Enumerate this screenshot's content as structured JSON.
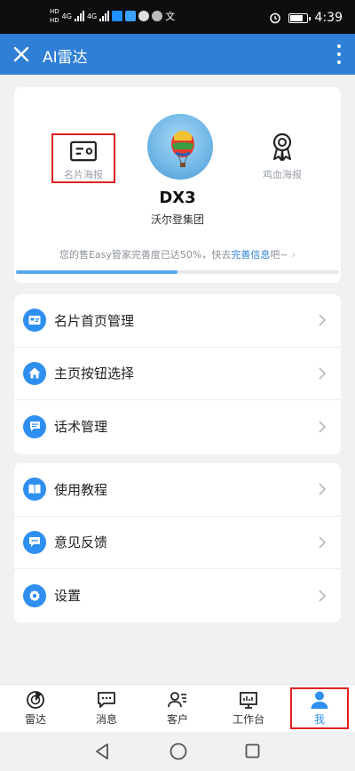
{
  "status_bar": {
    "time": "4:39",
    "network_left": "4G",
    "network_right": "4G"
  },
  "app_bar": {
    "title": "AI雷达"
  },
  "profile": {
    "left_poster_label": "名片海报",
    "right_poster_label": "鸡血海报",
    "name": "DX3",
    "organization": "沃尔登集团",
    "completeness_prefix": "您的售Easy管家完善度已达50%，快去",
    "completeness_link": "完善信息",
    "completeness_suffix": "吧~",
    "completeness_percent": 50
  },
  "menu_group_1": [
    {
      "label": "名片首页管理",
      "icon": "card-icon"
    },
    {
      "label": "主页按钮选择",
      "icon": "home-icon"
    },
    {
      "label": "话术管理",
      "icon": "script-icon"
    }
  ],
  "menu_group_2": [
    {
      "label": "使用教程",
      "icon": "book-icon"
    },
    {
      "label": "意见反馈",
      "icon": "feedback-icon"
    },
    {
      "label": "设置",
      "icon": "gear-icon"
    }
  ],
  "bottom_nav": [
    {
      "label": "雷达",
      "icon": "radar-icon"
    },
    {
      "label": "消息",
      "icon": "message-icon"
    },
    {
      "label": "客户",
      "icon": "customer-icon"
    },
    {
      "label": "工作台",
      "icon": "workbench-icon"
    },
    {
      "label": "我",
      "icon": "user-icon",
      "active": true
    }
  ],
  "colors": {
    "primary": "#2f7fd6",
    "accent": "#2f8ff0",
    "highlight_box": "#e0201f"
  }
}
